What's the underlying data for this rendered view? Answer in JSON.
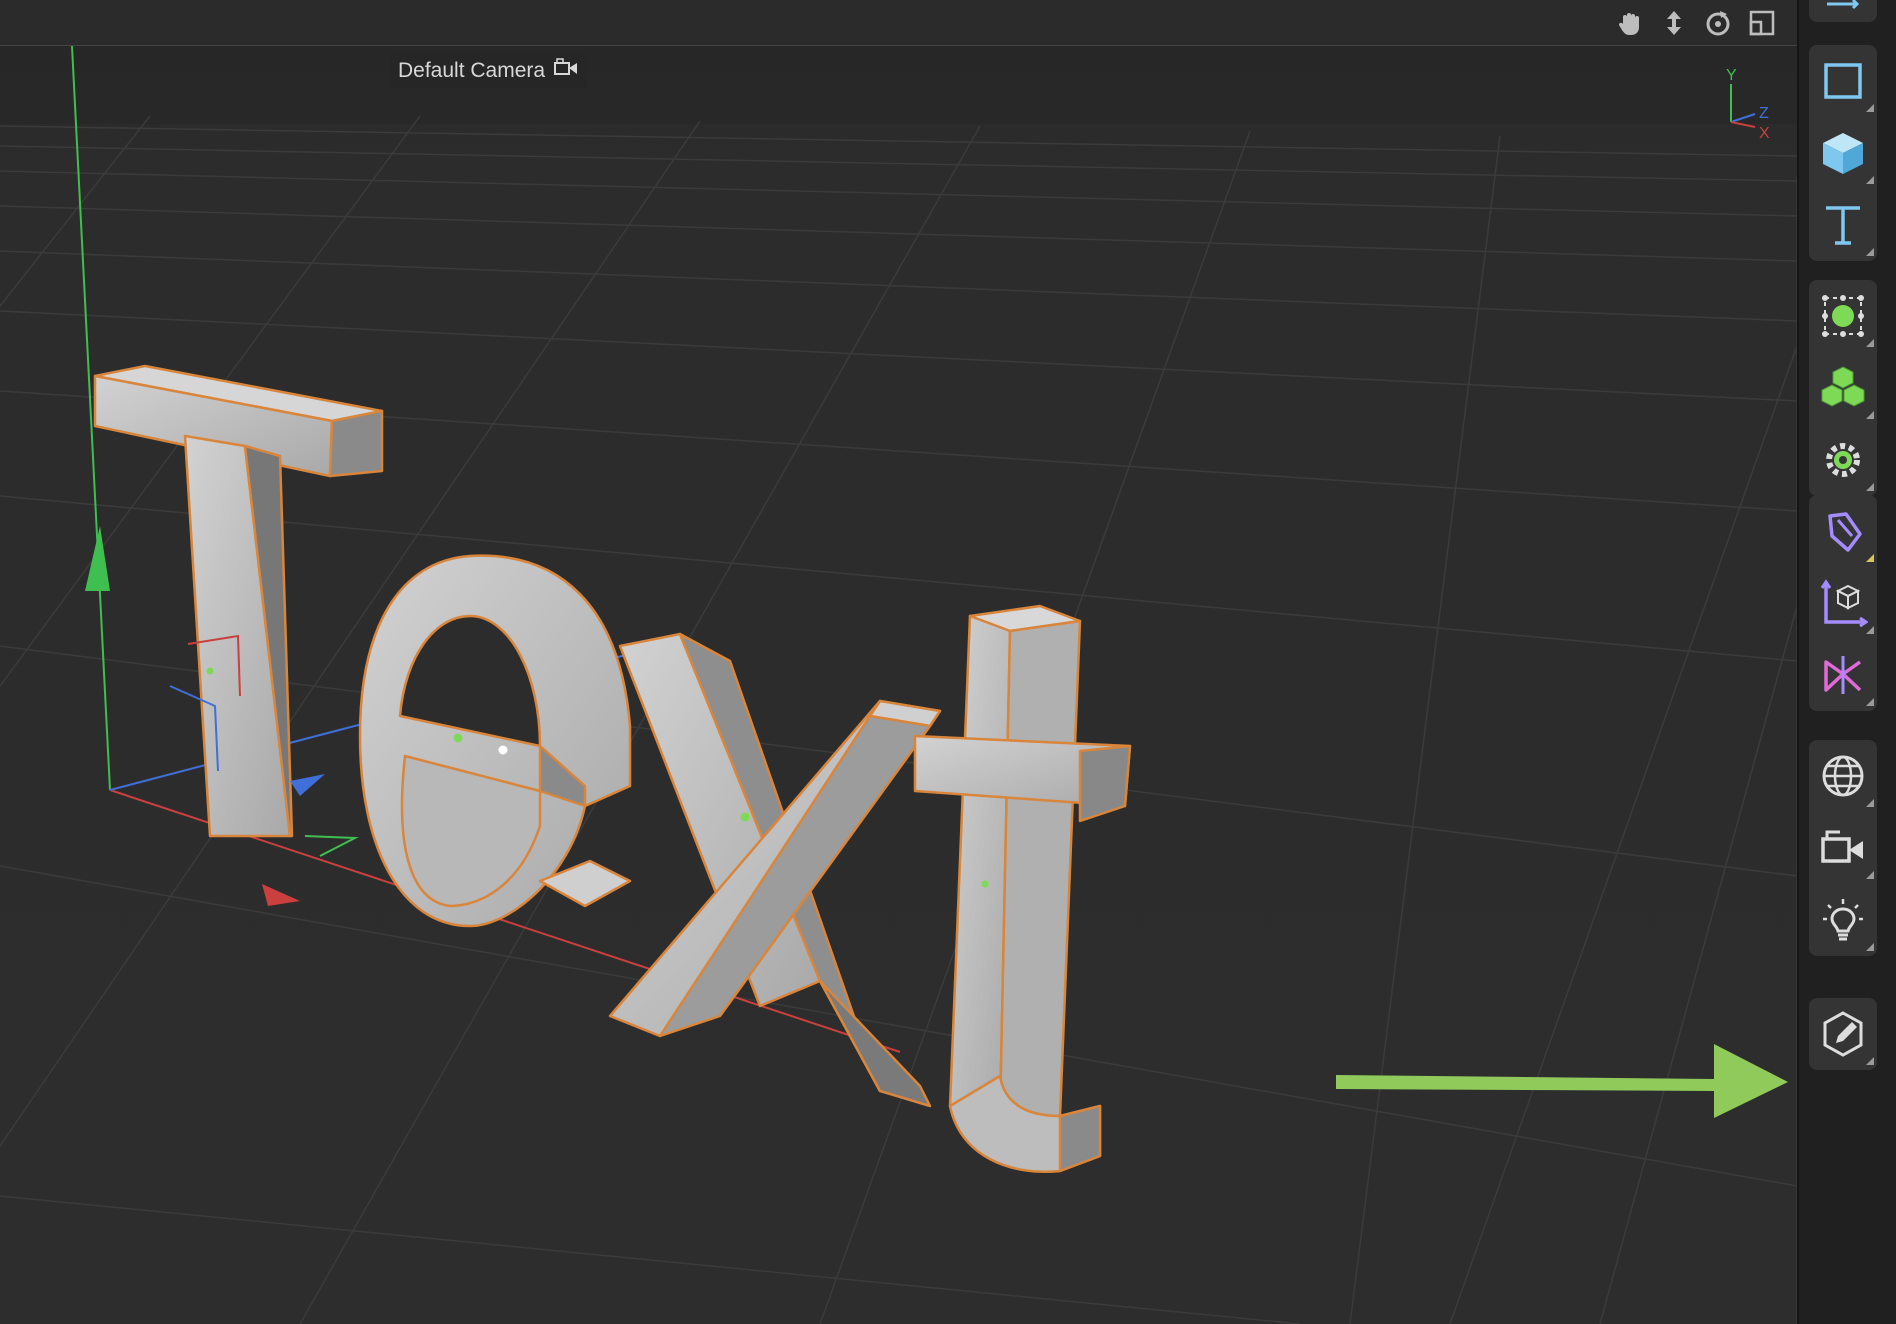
{
  "viewport": {
    "camera_label": "Default Camera",
    "camera_icon": "camera-icon",
    "scene_text": "Text",
    "nav_icons": [
      "hand-pan-icon",
      "move-updown-icon",
      "orbit-icon",
      "maximize-view-icon"
    ],
    "axis_gizmo": {
      "y": "Y",
      "z": "Z",
      "x": "X"
    }
  },
  "toolbar": {
    "groups": [
      [
        "rectangle-icon",
        "cube-icon",
        "text-icon"
      ],
      [
        "generator-icon",
        "cloner-icon",
        "deformer-gear-icon"
      ],
      [
        "spline-pen-icon",
        "coordinate-icon",
        "symmetry-icon"
      ],
      [
        "globe-icon",
        "camera-icon",
        "light-bulb-icon"
      ],
      [
        "edit-pencil-icon"
      ]
    ]
  },
  "colors": {
    "background": "#2c2c2c",
    "grid": "#3d3d3d",
    "accent_blue": "#7ec8f0",
    "accent_green": "#7ed957",
    "accent_purple": "#a48cff",
    "outline_orange": "#e08a3c",
    "annotation_arrow": "#8fca5a"
  }
}
